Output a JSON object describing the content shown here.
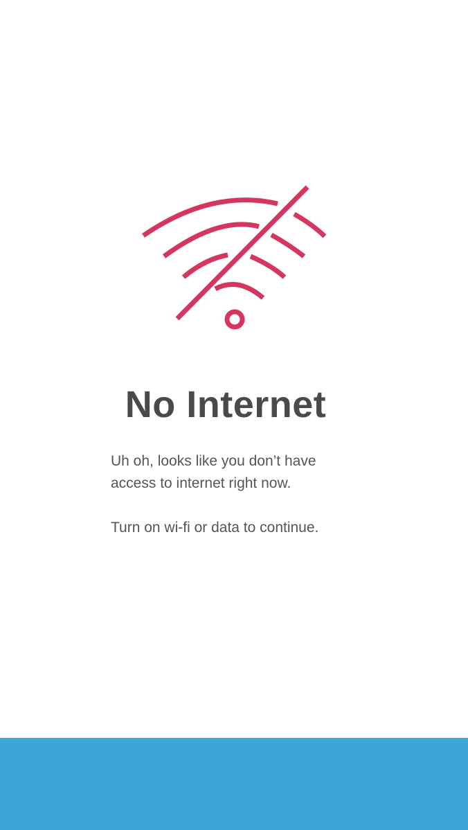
{
  "screen": {
    "icon": "no-wifi-icon",
    "title": "No Internet",
    "message_line_1": "Uh oh, looks like you don’t have",
    "message_line_2": "access to internet right now.",
    "message_line_3": "Turn on wi-fi or data to continue."
  },
  "colors": {
    "accent": "#d4365e",
    "title_text": "#4a4a4a",
    "body_text": "#555555",
    "bottom_bar": "#3ea5d7",
    "background": "#ffffff"
  }
}
